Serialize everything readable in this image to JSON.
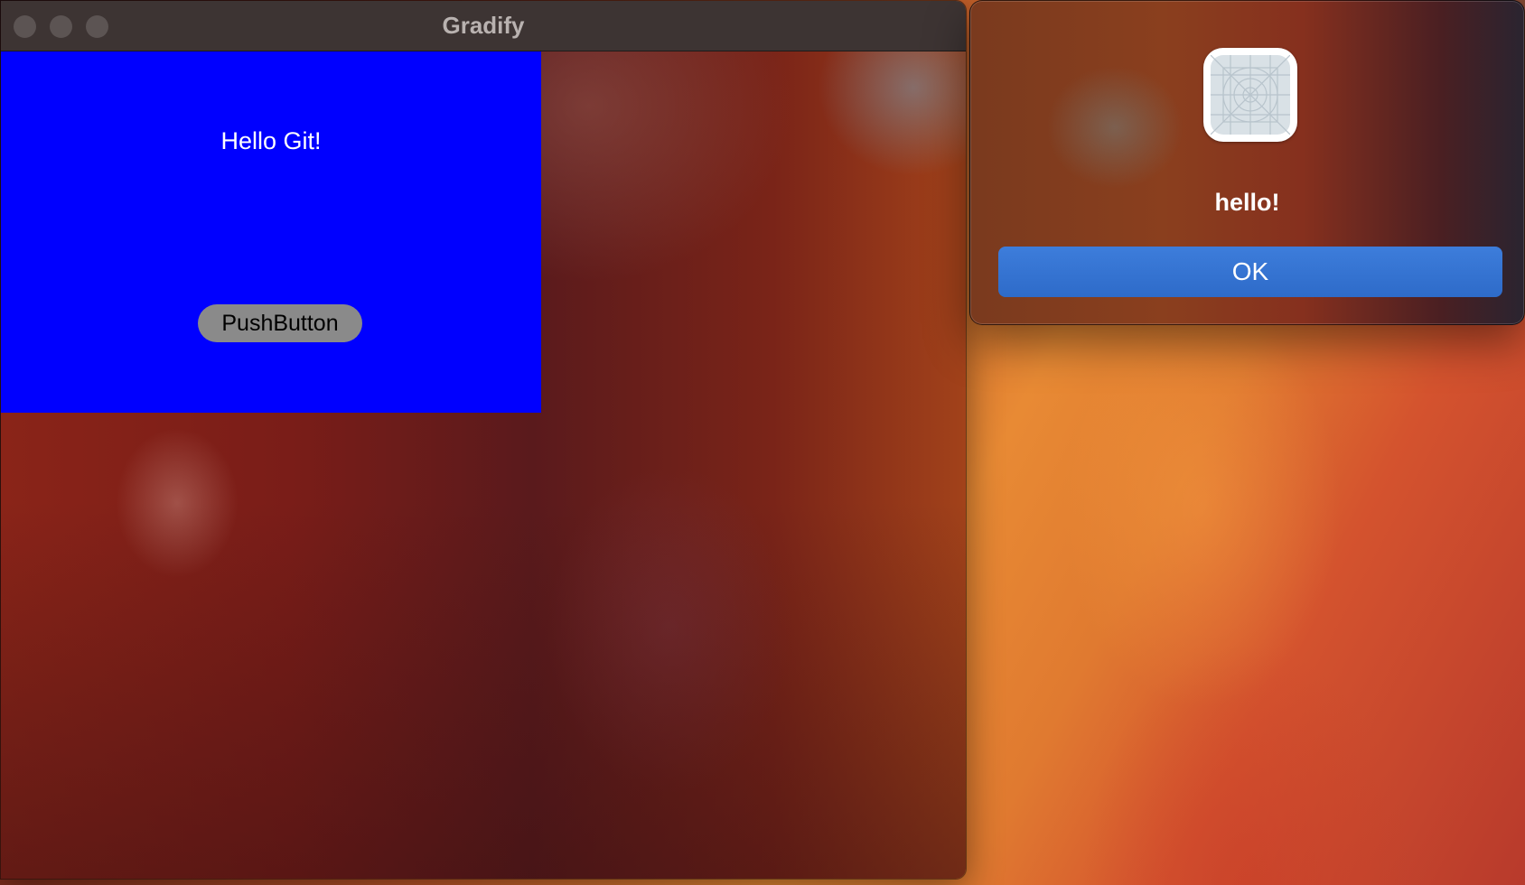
{
  "window": {
    "title": "Gradify",
    "traffic_lights": [
      "close",
      "minimize",
      "zoom"
    ]
  },
  "panel": {
    "background_color": "#0000ff",
    "label": "Hello Git!",
    "button_label": "PushButton"
  },
  "alert": {
    "icon": "app-placeholder-icon",
    "message": "hello!",
    "ok_label": "OK",
    "accent_color": "#3370d3"
  }
}
